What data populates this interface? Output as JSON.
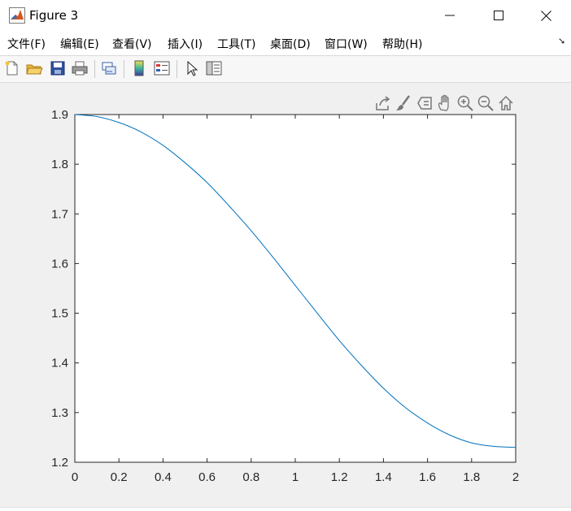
{
  "window": {
    "title": "Figure 3"
  },
  "menu": [
    "文件(F)",
    "编辑(E)",
    "查看(V)",
    "插入(I)",
    "工具(T)",
    "桌面(D)",
    "窗口(W)",
    "帮助(H)"
  ],
  "toolbar_icons": [
    "new-file-icon",
    "open-folder-icon",
    "save-icon",
    "print-icon",
    "link-plot-icon",
    "colorbar-icon",
    "legend-icon",
    "pointer-icon",
    "property-editor-icon"
  ],
  "axes_toolbar_icons": [
    "export-icon",
    "brush-icon",
    "datatip-icon",
    "pan-icon",
    "zoom-in-icon",
    "zoom-out-icon",
    "home-icon"
  ],
  "colors": {
    "line": "#0072BD",
    "figure_bg": "#f0f0f0",
    "axes_bg": "#ffffff"
  },
  "chart_data": {
    "type": "line",
    "title": "",
    "xlabel": "",
    "ylabel": "",
    "xlim": [
      0,
      2
    ],
    "ylim": [
      1.2,
      1.9
    ],
    "xticks": [
      0,
      0.2,
      0.4,
      0.6,
      0.8,
      1,
      1.2,
      1.4,
      1.6,
      1.8,
      2
    ],
    "xtick_labels": [
      "0",
      "0.2",
      "0.4",
      "0.6",
      "0.8",
      "1",
      "1.2",
      "1.4",
      "1.6",
      "1.8",
      "2"
    ],
    "yticks": [
      1.2,
      1.3,
      1.4,
      1.5,
      1.6,
      1.7,
      1.8,
      1.9
    ],
    "ytick_labels": [
      "1.2",
      "1.3",
      "1.4",
      "1.5",
      "1.6",
      "1.7",
      "1.8",
      "1.9"
    ],
    "grid": false,
    "series": [
      {
        "x": [
          0,
          0.1,
          0.2,
          0.3,
          0.4,
          0.5,
          0.6,
          0.7,
          0.8,
          0.9,
          1.0,
          1.1,
          1.2,
          1.3,
          1.4,
          1.5,
          1.6,
          1.7,
          1.8,
          1.9,
          2.0
        ],
        "y": [
          1.9,
          1.896,
          1.884,
          1.865,
          1.838,
          1.803,
          1.763,
          1.716,
          1.666,
          1.612,
          1.556,
          1.5,
          1.445,
          1.395,
          1.349,
          1.31,
          1.279,
          1.255,
          1.239,
          1.232,
          1.23
        ]
      }
    ]
  }
}
